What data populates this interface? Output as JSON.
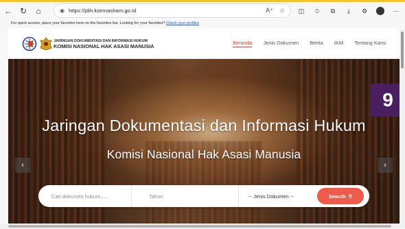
{
  "browser": {
    "url": "https://jdih.komnasham.go.id",
    "favorites_message": "For quick access, place your favorites here on the favorites bar. Looking for your favorites?",
    "favorites_link": "Check your profiles"
  },
  "site": {
    "brand_line1": "JARINGAN DOKUMENTASI DAN INFORMASI HUKUM",
    "brand_line2": "KOMISI NASIONAL HAK ASASI MANUSIA",
    "nav": [
      "Beranda",
      "Jenis Dokumen",
      "Berita",
      "IKM",
      "Tentang Kami"
    ],
    "active_nav": "Beranda"
  },
  "hero": {
    "title": "Jaringan Dokumentasi dan Informasi Hukum",
    "subtitle": "Komisi Nasional Hak Asasi Manusia",
    "badge": "9"
  },
  "search": {
    "document_placeholder": "Cari dokumen hukum......",
    "year_placeholder": "Tahun",
    "type_selected": "-- Jenis Dokumen --",
    "button_label": "Search"
  },
  "colors": {
    "accent": "#ef5b4a",
    "active_nav": "#d6402f",
    "badge": "#4b1f5f",
    "top_strip": "#f5c518"
  }
}
